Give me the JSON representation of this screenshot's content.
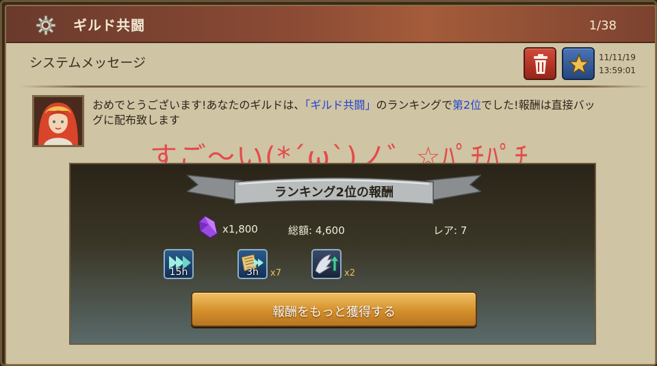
{
  "header": {
    "title": "ギルド共闘",
    "page_count": "1/38",
    "icon": "gear-icon"
  },
  "mail": {
    "subject": "システムメッセージ",
    "date": "11/11/19",
    "time": "13:59:01",
    "delete_icon": "trash-icon",
    "favorite_icon": "star-icon",
    "sender_icon": "avatar",
    "message_part1": "おめでとうございます!あなたのギルドは、",
    "message_event": "「ギルド共闘」",
    "message_part2": "のランキングで",
    "message_rank": "第2位",
    "message_part3": "でした!報酬は直接バッグに配布致します"
  },
  "overlay_text": "すご〜い(*´ω`)ノ゛☆ﾊﾟﾁﾊﾟﾁ",
  "reward": {
    "title": "ランキング2位の報酬",
    "gem_icon": "gem-icon",
    "gem_amount": "x1,800",
    "total_label": "総額: 4,600",
    "rarity_label": "レア: 7",
    "items": [
      {
        "icon": "speedup-icon",
        "label": "15h",
        "qty": ""
      },
      {
        "icon": "research-speedup-icon",
        "label": "3h",
        "qty": "x7"
      },
      {
        "icon": "troop-upgrade-icon",
        "label": "",
        "qty": "x2"
      }
    ],
    "button_label": "報酬をもっと獲得する"
  },
  "colors": {
    "header": "#8c4b35",
    "panel": "#cfc4a4",
    "highlight_text": "#2244cc",
    "overlay_text": "#e44a4a",
    "button": "#d4902c"
  }
}
